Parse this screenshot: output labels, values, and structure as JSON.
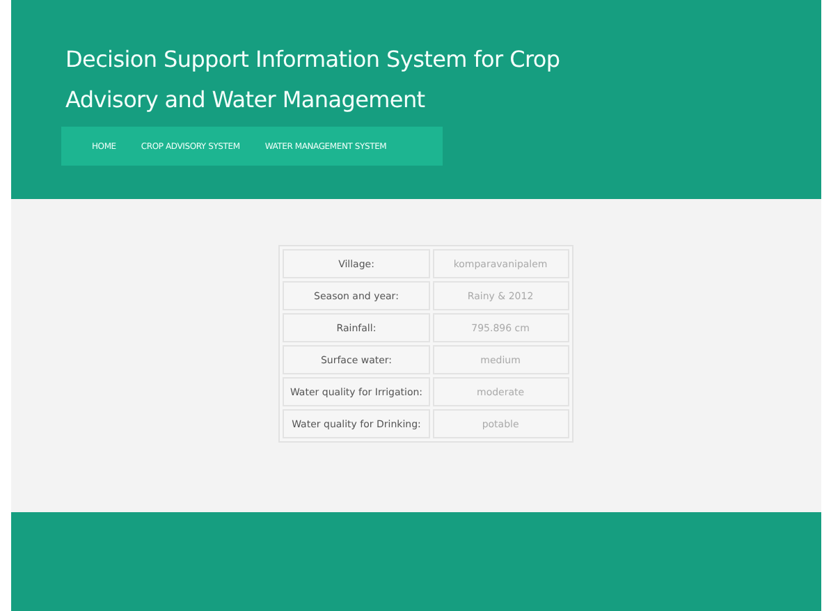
{
  "header": {
    "title": "Decision Support Information System for Crop Advisory and Water Management"
  },
  "nav": [
    {
      "label": "HOME"
    },
    {
      "label": "CROP ADVISORY SYSTEM"
    },
    {
      "label": "WATER MANAGEMENT SYSTEM"
    }
  ],
  "table": {
    "rows": [
      {
        "label": "Village:",
        "value": "komparavanipalem"
      },
      {
        "label": "Season and year:",
        "value": "Rainy & 2012"
      },
      {
        "label": "Rainfall:",
        "value": "795.896 cm"
      },
      {
        "label": "Surface water:",
        "value": "medium"
      },
      {
        "label": "Water quality for Irrigation:",
        "value": "moderate"
      },
      {
        "label": "Water quality for Drinking:",
        "value": "potable"
      }
    ]
  }
}
